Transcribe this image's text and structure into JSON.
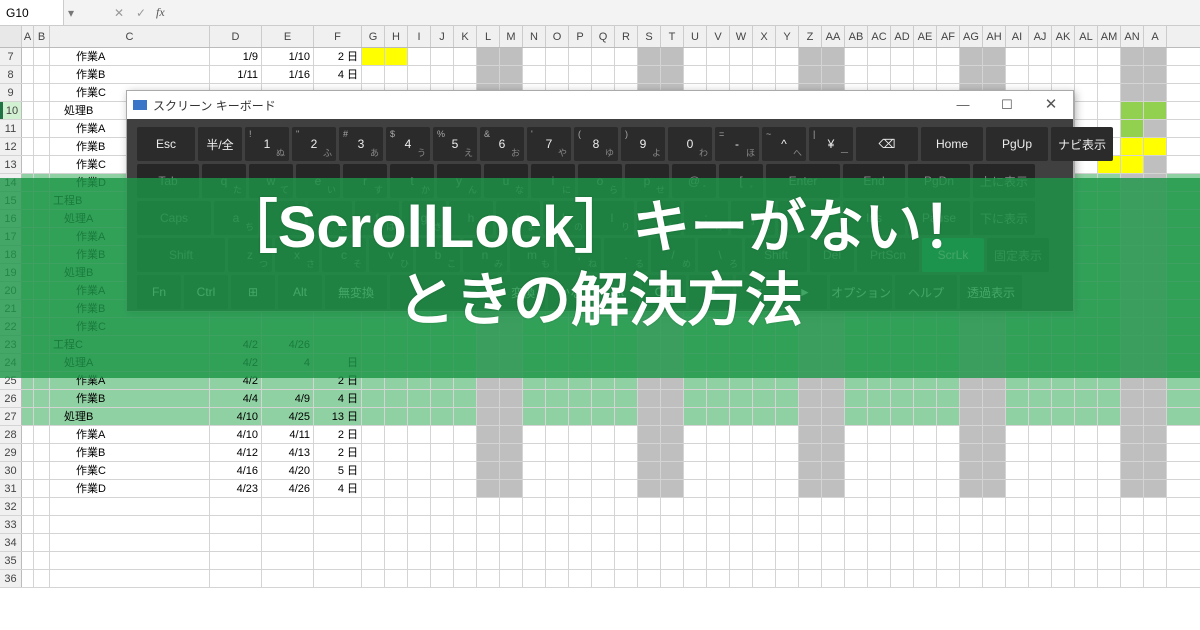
{
  "formula_bar": {
    "cell_ref": "G10",
    "cancel": "✕",
    "confirm": "✓",
    "fx": "fx"
  },
  "columns_main": [
    "A",
    "B",
    "C",
    "D",
    "E",
    "F"
  ],
  "columns_narrow": [
    "G",
    "H",
    "I",
    "J",
    "K",
    "L",
    "M",
    "N",
    "O",
    "P",
    "Q",
    "R",
    "S",
    "T",
    "U",
    "V",
    "W",
    "X",
    "Y",
    "Z",
    "AA",
    "AB",
    "AC",
    "AD",
    "AE",
    "AF",
    "AG",
    "AH",
    "AI",
    "AJ",
    "AK",
    "AL",
    "AM",
    "AN",
    "A"
  ],
  "rows": [
    {
      "n": 7,
      "name": "作業A",
      "ind": 2,
      "d": "1/9",
      "e": "1/10",
      "f": "2 日",
      "hl": {
        "yellow": [
          0,
          1
        ]
      }
    },
    {
      "n": 8,
      "name": "作業B",
      "ind": 2,
      "d": "1/11",
      "e": "1/16",
      "f": "4 日"
    },
    {
      "n": 9,
      "name": "作業C",
      "ind": 2
    },
    {
      "n": 10,
      "name": "処理B",
      "ind": 1,
      "sel": true,
      "far": {
        "lgreen": [
          33,
          34
        ]
      }
    },
    {
      "n": 11,
      "name": "作業A",
      "ind": 2,
      "far": {
        "lgreen": [
          33
        ]
      }
    },
    {
      "n": 12,
      "name": "作業B",
      "ind": 2,
      "far": {
        "yellow": [
          33,
          34
        ]
      }
    },
    {
      "n": 13,
      "name": "作業C",
      "ind": 2,
      "far": {
        "yellow": [
          32,
          33
        ]
      }
    },
    {
      "n": 14,
      "name": "作業D",
      "ind": 2,
      "green": true
    },
    {
      "n": 15,
      "name": "工程B",
      "ind": 0,
      "green": true
    },
    {
      "n": 16,
      "name": "処理A",
      "ind": 1,
      "green": true
    },
    {
      "n": 17,
      "name": "作業A",
      "ind": 2,
      "green": true
    },
    {
      "n": 18,
      "name": "作業B",
      "ind": 2,
      "green": true
    },
    {
      "n": 19,
      "name": "処理B",
      "ind": 1,
      "green": true
    },
    {
      "n": 20,
      "name": "作業A",
      "ind": 2,
      "green": true
    },
    {
      "n": 21,
      "name": "作業B",
      "ind": 2,
      "green": true
    },
    {
      "n": 22,
      "name": "作業C",
      "ind": 2,
      "green": true
    },
    {
      "n": 23,
      "name": "工程C",
      "ind": 0,
      "d": "4/2",
      "e": "4/26",
      "green": true
    },
    {
      "n": 24,
      "name": "処理A",
      "ind": 1,
      "d": "4/2",
      "e": "4",
      "f": "日",
      "green": true
    },
    {
      "n": 25,
      "name": "作業A",
      "ind": 2,
      "d": "4/2",
      "f": "2 日",
      "green": true
    },
    {
      "n": 26,
      "name": "作業B",
      "ind": 2,
      "d": "4/4",
      "e": "4/9",
      "f": "4 日",
      "green": true
    },
    {
      "n": 27,
      "name": "処理B",
      "ind": 1,
      "d": "4/10",
      "e": "4/25",
      "f": "13 日",
      "green": true
    },
    {
      "n": 28,
      "name": "作業A",
      "ind": 2,
      "d": "4/10",
      "e": "4/11",
      "f": "2 日"
    },
    {
      "n": 29,
      "name": "作業B",
      "ind": 2,
      "d": "4/12",
      "e": "4/13",
      "f": "2 日"
    },
    {
      "n": 30,
      "name": "作業C",
      "ind": 2,
      "d": "4/16",
      "e": "4/20",
      "f": "5 日"
    },
    {
      "n": 31,
      "name": "作業D",
      "ind": 2,
      "d": "4/23",
      "e": "4/26",
      "f": "4 日"
    },
    {
      "n": 32
    },
    {
      "n": 33
    },
    {
      "n": 34
    },
    {
      "n": 35
    },
    {
      "n": 36
    }
  ],
  "gray_cols": [
    5,
    6,
    12,
    13,
    19,
    20,
    26,
    27,
    33,
    34
  ],
  "osk": {
    "title": "スクリーン キーボード",
    "row1": {
      "esc": "Esc",
      "han": "半/全",
      "nums": [
        [
          "!",
          "1",
          "ぬ"
        ],
        [
          "\"",
          "2",
          "ふ"
        ],
        [
          "#",
          "3",
          "あ"
        ],
        [
          "$",
          "4",
          "う"
        ],
        [
          "%",
          "5",
          "え"
        ],
        [
          "&",
          "6",
          "お"
        ],
        [
          "'",
          "7",
          "や"
        ],
        [
          "(",
          "8",
          "ゆ"
        ],
        [
          ")",
          "9",
          "よ"
        ],
        [
          "",
          "0",
          "わ"
        ],
        [
          "=",
          "-",
          "ほ"
        ],
        [
          "~",
          "^",
          "へ"
        ],
        [
          "|",
          "¥",
          "ー"
        ]
      ],
      "bs": "⌫",
      "home": "Home",
      "pgup": "PgUp",
      "nav": "ナビ表示"
    },
    "row2": {
      "tab": "Tab",
      "keys": [
        [
          "q",
          "た"
        ],
        [
          "w",
          "て"
        ],
        [
          "e",
          "い"
        ],
        [
          "r",
          "す"
        ],
        [
          "t",
          "か"
        ],
        [
          "y",
          "ん"
        ],
        [
          "u",
          "な"
        ],
        [
          "i",
          "に"
        ],
        [
          "o",
          "ら"
        ],
        [
          "p",
          "せ"
        ],
        [
          "@",
          "゛"
        ],
        [
          "[",
          "゜"
        ]
      ],
      "enter": "Enter",
      "end": "End",
      "pgdn": "PgDn",
      "up": "上に表示"
    },
    "row3": {
      "caps": "Caps",
      "keys": [
        [
          "a",
          "ち"
        ],
        [
          "s",
          "と"
        ],
        [
          "d",
          "し"
        ],
        [
          "f",
          "は"
        ],
        [
          "g",
          "き"
        ],
        [
          "h",
          "く"
        ],
        [
          "j",
          "ま"
        ],
        [
          "k",
          "の"
        ],
        [
          "l",
          "り"
        ],
        [
          ";",
          "れ"
        ],
        [
          ":",
          "け"
        ],
        [
          "]",
          "む"
        ]
      ],
      "ins": "Ins",
      "pause": "Pause",
      "down": "下に表示"
    },
    "row4": {
      "shift": "Shift",
      "keys": [
        [
          "z",
          "つ"
        ],
        [
          "x",
          "さ"
        ],
        [
          "c",
          "そ"
        ],
        [
          "v",
          "ひ"
        ],
        [
          "b",
          "こ"
        ],
        [
          "n",
          "み"
        ],
        [
          "m",
          "も"
        ],
        [
          ",",
          "ね"
        ],
        [
          ".",
          "る"
        ],
        [
          "/",
          "め"
        ],
        [
          "\\",
          "ろ"
        ]
      ],
      "shiftr": "Shift",
      "del": "Del",
      "prtscn": "PrtScn",
      "scrlk": "ScrLk",
      "fix": "固定表示"
    },
    "row5": {
      "fn": "Fn",
      "ctrl": "Ctrl",
      "win": "⊞",
      "alt": "Alt",
      "muhen": "無変換",
      "space": "",
      "henkan": "変換",
      "kana": "かな",
      "altr": "Alt",
      "ctrlr": "Ctrl",
      "left": "◄",
      "down": "▼",
      "right": "►",
      "opt": "オプション",
      "help": "ヘルプ",
      "trans": "透過表示"
    }
  },
  "headline": {
    "l1": "［ScrollLock］キーがない！",
    "l2": "ときの解決方法"
  }
}
